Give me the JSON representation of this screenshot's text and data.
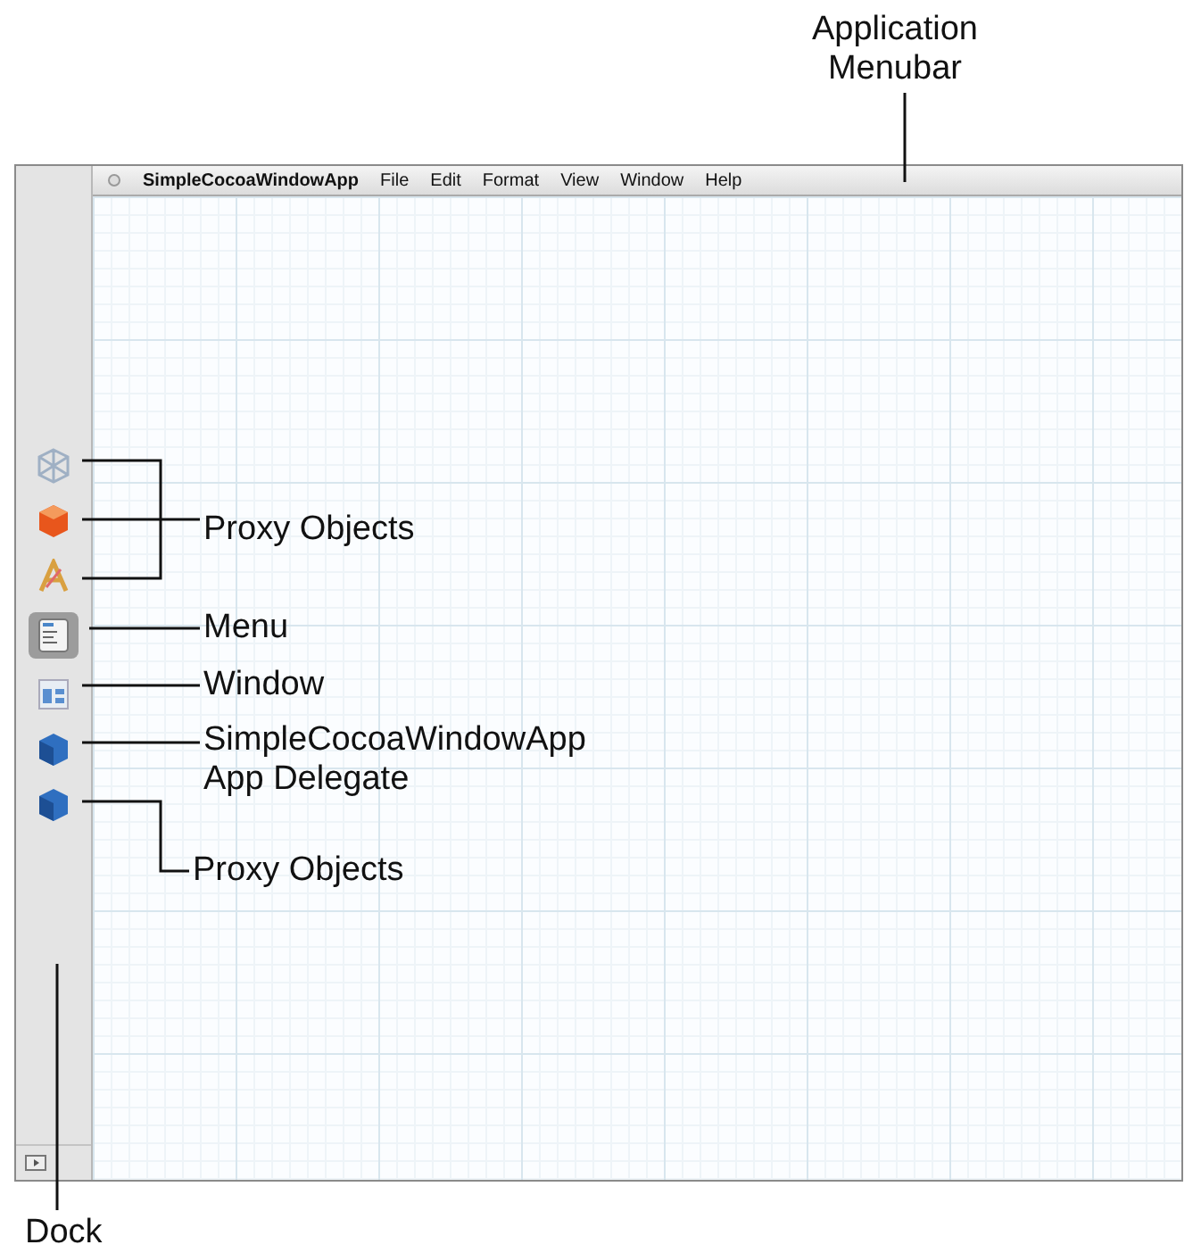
{
  "menubar": {
    "items": [
      "SimpleCocoaWindowApp",
      "File",
      "Edit",
      "Format",
      "View",
      "Window",
      "Help"
    ]
  },
  "dock": {
    "items": [
      {
        "kind": "cube-outline",
        "selected": false
      },
      {
        "kind": "cube-orange",
        "selected": false
      },
      {
        "kind": "app",
        "selected": false
      },
      {
        "kind": "menu",
        "selected": true
      },
      {
        "kind": "window",
        "selected": false
      },
      {
        "kind": "cube-blue",
        "selected": false
      },
      {
        "kind": "cube-blue",
        "selected": false
      }
    ]
  },
  "callouts": [
    {
      "kind": "menubar",
      "lines": [
        "Application",
        "Menubar"
      ]
    },
    {
      "kind": "bracket-top",
      "lines": [
        "Proxy Objects"
      ]
    },
    {
      "kind": "menu",
      "lines": [
        "Menu"
      ]
    },
    {
      "kind": "window",
      "lines": [
        "Window"
      ]
    },
    {
      "kind": "delegate",
      "lines": [
        "SimpleCocoaWindowApp",
        "App Delegate"
      ]
    },
    {
      "kind": "bracket-bottom",
      "lines": [
        "Proxy Objects"
      ]
    },
    {
      "kind": "dock",
      "lines": [
        "Dock"
      ]
    }
  ]
}
